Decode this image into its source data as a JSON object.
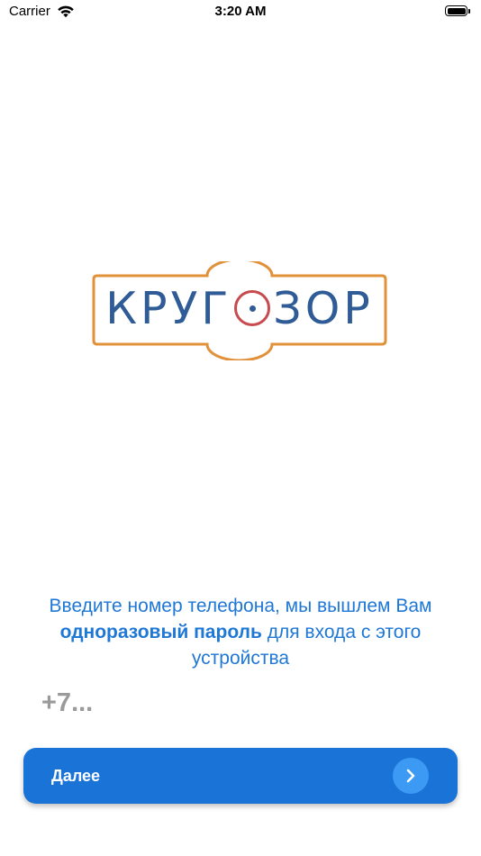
{
  "status_bar": {
    "carrier": "Carrier",
    "time": "3:20 AM",
    "wifi_icon": "wifi-icon",
    "battery_icon": "battery-icon"
  },
  "logo": {
    "text_before_ring": "КРУГ",
    "text_after_ring": "ЗОР",
    "colors": {
      "frame": "#e0913a",
      "text": "#2f5b96",
      "ring": "#c74a4e"
    }
  },
  "prompt": {
    "part1": "Введите номер телефона, мы вышлем Вам",
    "bold": "одноразовый пароль",
    "part2": " для входа с этого устройства"
  },
  "phone_input": {
    "placeholder": "+7...",
    "value": ""
  },
  "next_button": {
    "label": "Далее",
    "icon": "chevron-right-icon",
    "color": "#1a73d6"
  }
}
